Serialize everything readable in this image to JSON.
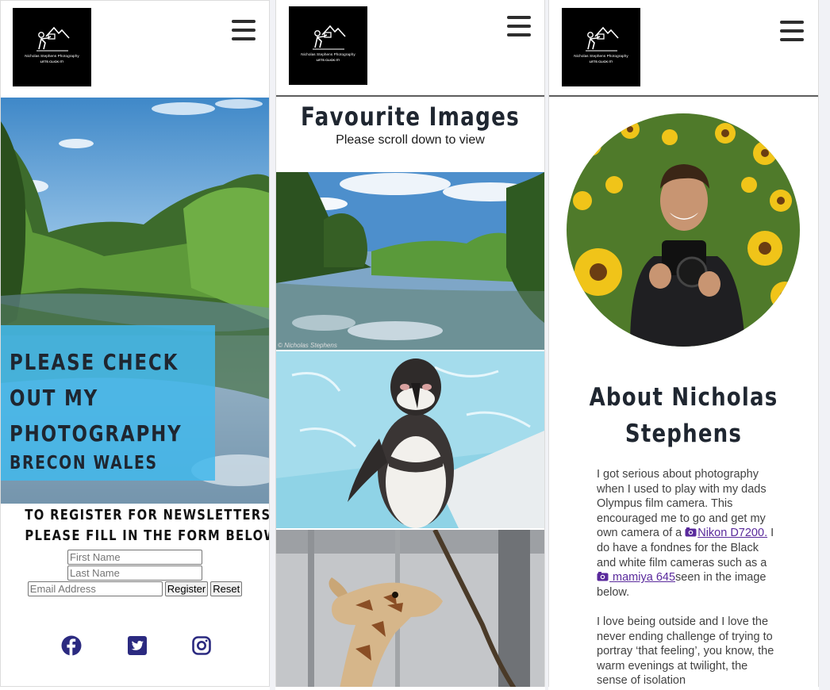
{
  "logo": {
    "line1": "Nicholas Stephens Photography",
    "line2": "LETS CLICK IT!"
  },
  "home": {
    "hero_line1": "PLEASE CHECK",
    "hero_line2": "OUT MY",
    "hero_line3": "PHOTOGRAPHY",
    "hero_line4": "BRECON WALES",
    "newsletter_line1": "TO REGISTER FOR NEWSLETTERS",
    "newsletter_line2": "PLEASE FILL IN THE FORM BELOW:",
    "form": {
      "first_name_placeholder": "First Name",
      "last_name_placeholder": "Last Name",
      "email_placeholder": "Email Address",
      "register_label": "Register",
      "reset_label": "Reset"
    },
    "social_icons": [
      "facebook-icon",
      "twitter-icon",
      "instagram-icon"
    ],
    "social_color": "#2b2a80",
    "hero_box_color": "#42b8eb"
  },
  "favourites": {
    "title": "Favourite Images",
    "subtitle": "Please scroll down to view",
    "credit": "© Nicholas Stephens"
  },
  "about": {
    "title_line1": "About Nicholas",
    "title_line2": "Stephens",
    "p1_part1": "I got serious about photography when I used to play with my dads Olympus film camera. This encouraged me to go and get my own camera of a ",
    "link1": "Nikon D7200.",
    "p1_part2": " I do have a fondnes for the Black and white film cameras such as a ",
    "link2": " mamiya 645",
    "p1_part3": "seen in the image below.",
    "p2": "I love being outside and I love the never ending challenge of trying to portray ‘that feeling’, you know, the warm evenings at twilight, the sense of isolation",
    "link_color": "#5a2a9c"
  }
}
